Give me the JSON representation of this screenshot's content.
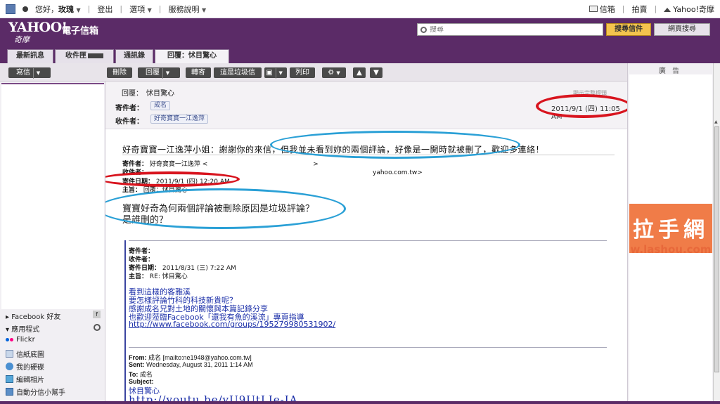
{
  "topbar": {
    "greeting": "您好，",
    "user": "玫瑰",
    "logout": "登出",
    "options": "選項",
    "help": "服務說明",
    "mail": "信箱",
    "auction": "拍賣",
    "home": "Yahoo!奇摩"
  },
  "header": {
    "logo": "YAHOO!",
    "logo_sub": "奇摩",
    "product": "電子信箱",
    "search_placeholder": "搜尋",
    "search_mail": "搜尋信件",
    "search_web": "網頁搜尋"
  },
  "tabs": [
    "最新訊息",
    "收件匣",
    "通訊錄",
    "回覆：怵目驚心"
  ],
  "toolbar": {
    "compose": "寫信",
    "delete": "刪除",
    "reply": "回覆",
    "forward": "轉寄",
    "spam": "這是垃圾信",
    "print": "列印"
  },
  "sidebar": {
    "facebook_friends": "Facebook 好友",
    "apps": "應用程式",
    "items": [
      "Flickr",
      "信紙底圖",
      "我的硬碟",
      "編輯相片",
      "自動分信小幫手"
    ]
  },
  "ad": {
    "label": "廣 告",
    "banner_text": "拉手網",
    "banner_url": "w.lashou.com"
  },
  "message": {
    "subject_label": "回覆：",
    "subject": "怵目驚心",
    "from_label": "寄件者：",
    "from": "成名",
    "to_label": "收件者：",
    "to": "好奇寶寶一江逸萍",
    "link_text": "顯示完整標頭",
    "date": "2011/9/1 (四) 11:05 AM",
    "body": "好奇寶寶一江逸萍小姐：謝謝你的來信，但我並未看到妳的兩個評論，好像是一開時就被刪了，歡迎多連絡！",
    "quote1": {
      "from_label": "寄件者：",
      "from": "好奇寶寶一江逸萍 <",
      "from_tail": ">",
      "to_label": "收件者：",
      "to_tail": "yahoo.com.tw>",
      "date_label": "寄件日期：",
      "date": "2011/9/1 (四) 12:20 AM",
      "subject_label": "主旨：",
      "subject": "回覆：怵目驚心",
      "text_line1": "寶寶好奇為何兩個評論被刪除原因是垃圾評論？",
      "text_line2": "是誰刪的？"
    },
    "quote2": {
      "from_label": "寄件者：",
      "to_label": "收件者：",
      "date_label": "寄件日期：",
      "date": "2011/8/31 (三) 7:22 AM",
      "subject_label": "主旨：",
      "subject": "RE: 怵目驚心",
      "lines": [
        "看到這樣的客雅溪",
        "要怎樣評論竹科的科技新貴呢？",
        "感謝成名兄對土地的關懷與本篇記錄分享",
        "也歡迎蒞臨Facebook「還我有魚的溪流」專頁指導"
      ],
      "url": "http://www.facebook.com/groups/195279980531902/"
    },
    "quote3": {
      "from_label": "From:",
      "from": "成名 [mailto:ne1948@yahoo.com.tw]",
      "sent_label": "Sent:",
      "sent": "Wednesday, August 31, 2011 1:14 AM",
      "to_label": "To:",
      "to": "成名",
      "subject_label": "Subject:",
      "subject": "怵目驚心",
      "url": "http://youtu.be/yU9UtLIe-IA"
    }
  },
  "colors": {
    "brand_purple": "#5b2b67",
    "annotation_red": "#d8141e",
    "annotation_blue": "#2aa0d6",
    "link_blue": "#1a2ea8"
  }
}
